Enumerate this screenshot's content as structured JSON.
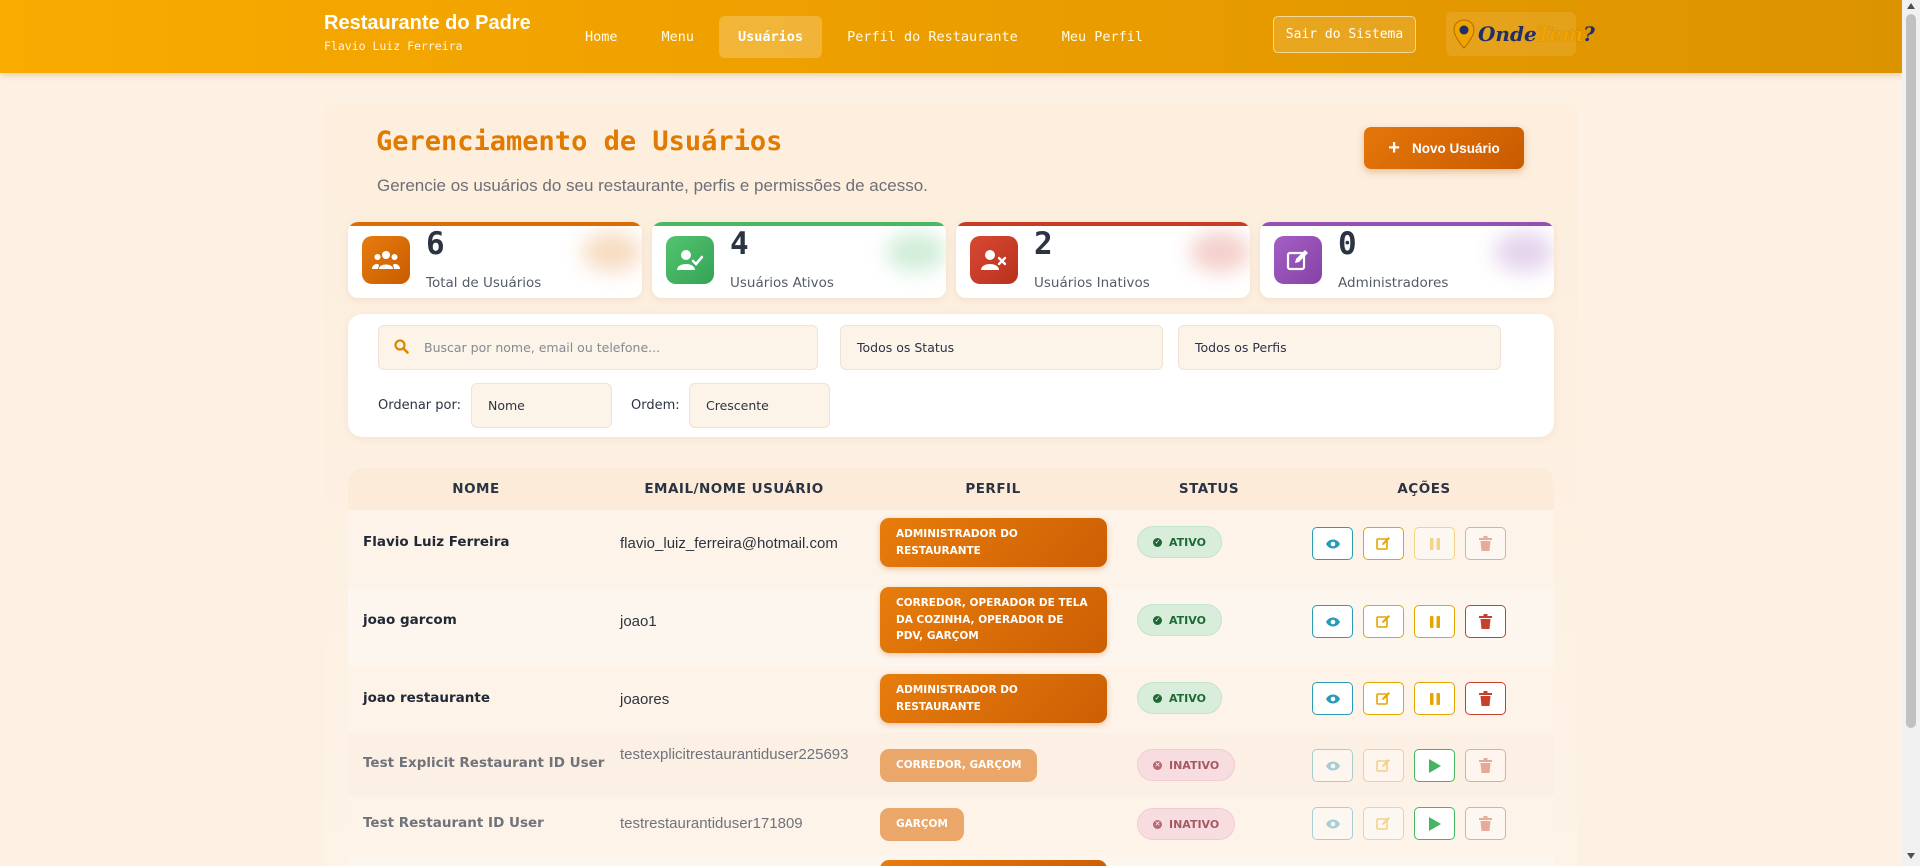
{
  "header": {
    "brand_title": "Restaurante do Padre",
    "brand_subtitle": "Flavio Luiz Ferreira",
    "nav": [
      {
        "label": "Home",
        "active": false
      },
      {
        "label": "Menu",
        "active": false
      },
      {
        "label": "Usuários",
        "active": true
      },
      {
        "label": "Perfil do Restaurante",
        "active": false
      },
      {
        "label": "Meu Perfil",
        "active": false
      }
    ],
    "logout_label": "Sair do Sistema",
    "logo": {
      "part1": "Onde",
      "part2": "Tem",
      "part3": "?"
    },
    "accent_color": "#f9ab00"
  },
  "page": {
    "title": "Gerenciamento de Usuários",
    "subtitle": "Gerencie os usuários do seu restaurante, perfis e permissões de acesso.",
    "new_user_label": "Novo Usuário"
  },
  "stats": [
    {
      "value": "6",
      "label": "Total de Usuários",
      "color": "#e27209",
      "icon": "users-icon"
    },
    {
      "value": "4",
      "label": "Usuários Ativos",
      "color": "#47b96a",
      "icon": "user-check-icon"
    },
    {
      "value": "2",
      "label": "Usuários Inativos",
      "color": "#d0402c",
      "icon": "user-x-icon"
    },
    {
      "value": "0",
      "label": "Administradores",
      "color": "#9451b3",
      "icon": "edit-icon"
    }
  ],
  "filters": {
    "search_placeholder": "Buscar por nome, email ou telefone...",
    "status_value": "Todos os Status",
    "profile_value": "Todos os Perfis",
    "sort_label": "Ordenar por:",
    "sort_value": "Nome",
    "order_label": "Ordem:",
    "order_value": "Crescente"
  },
  "table": {
    "columns": [
      "NOME",
      "EMAIL/NOME USUÁRIO",
      "PERFIL",
      "STATUS",
      "AÇÕES"
    ],
    "rows": [
      {
        "name": "Flavio Luiz Ferreira",
        "email": "flavio_luiz_ferreira@hotmail.com",
        "profile": "ADMINISTRADOR DO RESTAURANTE",
        "status": "ATIVO",
        "active": true
      },
      {
        "name": "joao garcom",
        "email": "joao1",
        "profile": "CORREDOR, OPERADOR DE TELA DA COZINHA, OPERADOR DE PDV, GARÇOM",
        "status": "ATIVO",
        "active": true
      },
      {
        "name": "joao restaurante",
        "email": "joaores",
        "profile": "ADMINISTRADOR DO RESTAURANTE",
        "status": "ATIVO",
        "active": true
      },
      {
        "name": "Test Explicit Restaurant ID User",
        "email": "testexplicitrestaurantiduser225693",
        "profile": "CORREDOR, GARÇOM",
        "status": "INATIVO",
        "active": false
      },
      {
        "name": "Test Restaurant ID User",
        "email": "testrestaurantiduser171809",
        "profile": "GARÇOM",
        "status": "INATIVO",
        "active": false
      }
    ]
  }
}
